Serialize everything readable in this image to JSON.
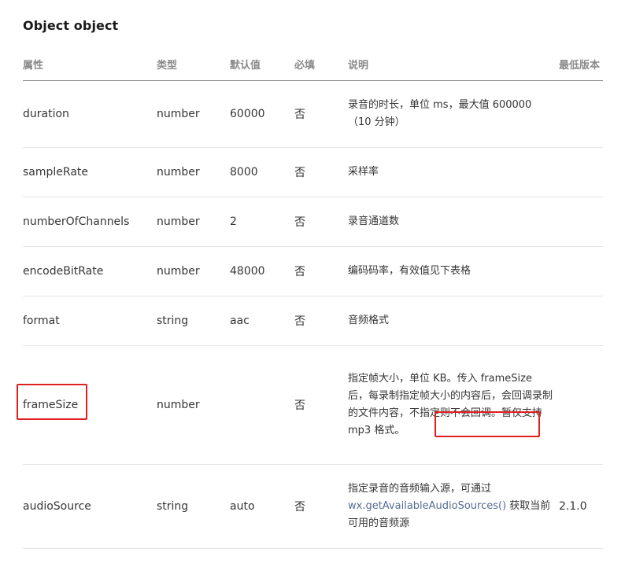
{
  "title": "Object object",
  "headers": [
    "属性",
    "类型",
    "默认值",
    "必填",
    "说明",
    "最低版本"
  ],
  "rows": [
    {
      "name": "duration",
      "type": "number",
      "default": "60000",
      "required": "否",
      "desc": "录音的时长，单位 ms，最大值 600000（10 分钟）",
      "desc_link": "",
      "desc_after": "",
      "version": ""
    },
    {
      "name": "sampleRate",
      "type": "number",
      "default": "8000",
      "required": "否",
      "desc": "采样率",
      "desc_link": "",
      "desc_after": "",
      "version": ""
    },
    {
      "name": "numberOfChannels",
      "type": "number",
      "default": "2",
      "required": "否",
      "desc": "录音通道数",
      "desc_link": "",
      "desc_after": "",
      "version": ""
    },
    {
      "name": "encodeBitRate",
      "type": "number",
      "default": "48000",
      "required": "否",
      "desc": "编码码率，有效值见下表格",
      "desc_link": "",
      "desc_after": "",
      "version": ""
    },
    {
      "name": "format",
      "type": "string",
      "default": "aac",
      "required": "否",
      "desc": "音频格式",
      "desc_link": "",
      "desc_after": "",
      "version": ""
    },
    {
      "name": "frameSize",
      "type": "number",
      "default": "",
      "required": "否",
      "desc": "指定帧大小，单位 KB。传入 frameSize 后，每录制指定帧大小的内容后，会回调录制的文件内容，不指定则不会回调。暂仅支持 mp3 格式。",
      "desc_link": "",
      "desc_after": "",
      "version": ""
    },
    {
      "name": "audioSource",
      "type": "string",
      "default": "auto",
      "required": "否",
      "desc": "指定录音的音频输入源，可通过 ",
      "desc_link": "wx.getAvailableAudioSources()",
      "desc_after": " 获取当前可用的音频源",
      "version": "2.1.0"
    }
  ],
  "colors": {
    "text": "#353535",
    "header_text": "#8a8a8a",
    "link": "#576b95",
    "highlight_box": "#e02020",
    "row_border": "#e5e5e5"
  }
}
